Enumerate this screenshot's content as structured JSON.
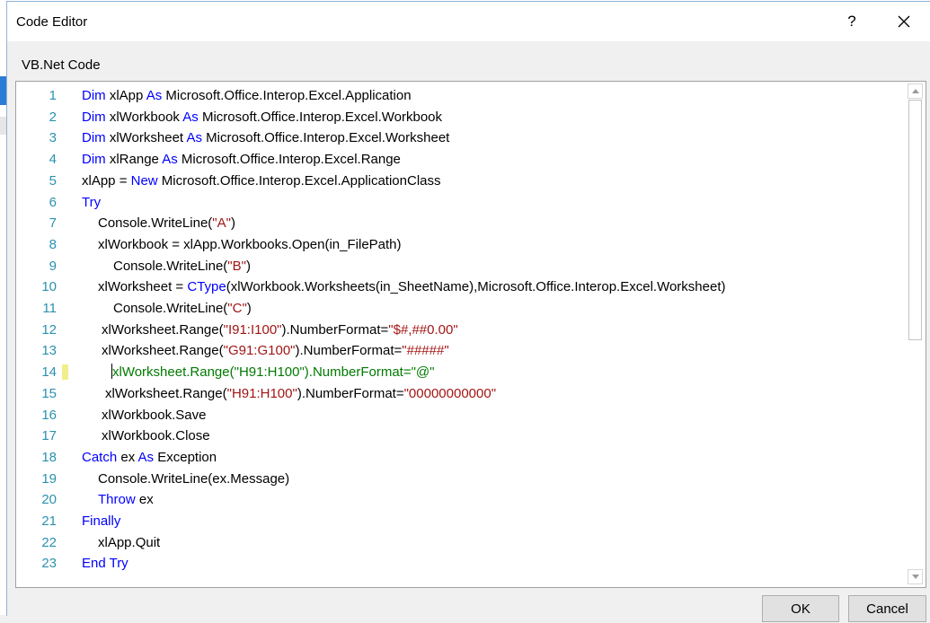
{
  "window": {
    "title": "Code Editor",
    "help_label": "?",
    "close_icon": "close-icon"
  },
  "section_label": "VB.Net Code",
  "editor": {
    "language": "VB.Net",
    "current_line": 14,
    "lines": [
      {
        "num": "1",
        "indent": 0,
        "tokens": [
          {
            "t": "Dim",
            "c": "kw"
          },
          {
            "t": " xlApp ",
            "c": ""
          },
          {
            "t": "As",
            "c": "kw"
          },
          {
            "t": " Microsoft.Office.Interop.Excel.Application",
            "c": ""
          }
        ]
      },
      {
        "num": "2",
        "indent": 0,
        "tokens": [
          {
            "t": "Dim",
            "c": "kw"
          },
          {
            "t": " xlWorkbook ",
            "c": ""
          },
          {
            "t": "As",
            "c": "kw"
          },
          {
            "t": " Microsoft.Office.Interop.Excel.Workbook",
            "c": ""
          }
        ]
      },
      {
        "num": "3",
        "indent": 0,
        "tokens": [
          {
            "t": "Dim",
            "c": "kw"
          },
          {
            "t": " xlWorksheet ",
            "c": ""
          },
          {
            "t": "As",
            "c": "kw"
          },
          {
            "t": " Microsoft.Office.Interop.Excel.Worksheet",
            "c": ""
          }
        ]
      },
      {
        "num": "4",
        "indent": 0,
        "tokens": [
          {
            "t": "Dim",
            "c": "kw"
          },
          {
            "t": " xlRange ",
            "c": ""
          },
          {
            "t": "As",
            "c": "kw"
          },
          {
            "t": " Microsoft.Office.Interop.Excel.Range",
            "c": ""
          }
        ]
      },
      {
        "num": "5",
        "indent": 0,
        "tokens": [
          {
            "t": "xlApp = ",
            "c": ""
          },
          {
            "t": "New",
            "c": "kw"
          },
          {
            "t": " Microsoft.Office.Interop.Excel.ApplicationClass",
            "c": ""
          }
        ]
      },
      {
        "num": "6",
        "indent": 0,
        "tokens": [
          {
            "t": "Try",
            "c": "kw"
          }
        ]
      },
      {
        "num": "7",
        "indent": 18,
        "tokens": [
          {
            "t": "Console.WriteLine(",
            "c": ""
          },
          {
            "t": "\"A\"",
            "c": "str"
          },
          {
            "t": ")",
            "c": ""
          }
        ]
      },
      {
        "num": "8",
        "indent": 18,
        "tokens": [
          {
            "t": "xlWorkbook = xlApp.Workbooks.Open(in_FilePath)",
            "c": ""
          }
        ]
      },
      {
        "num": "9",
        "indent": 35,
        "tokens": [
          {
            "t": "Console.WriteLine(",
            "c": ""
          },
          {
            "t": "\"B\"",
            "c": "str"
          },
          {
            "t": ")",
            "c": ""
          }
        ]
      },
      {
        "num": "10",
        "indent": 18,
        "tokens": [
          {
            "t": "xlWorksheet = ",
            "c": ""
          },
          {
            "t": "CType",
            "c": "kw"
          },
          {
            "t": "(xlWorkbook.Worksheets(in_SheetName),Microsoft.Office.Interop.Excel.Worksheet)",
            "c": ""
          }
        ]
      },
      {
        "num": "11",
        "indent": 35,
        "tokens": [
          {
            "t": "Console.WriteLine(",
            "c": ""
          },
          {
            "t": "\"C\"",
            "c": "str"
          },
          {
            "t": ")",
            "c": ""
          }
        ]
      },
      {
        "num": "12",
        "indent": 22,
        "tokens": [
          {
            "t": "xlWorksheet.Range(",
            "c": ""
          },
          {
            "t": "\"I91:I100\"",
            "c": "str"
          },
          {
            "t": ").NumberFormat=",
            "c": ""
          },
          {
            "t": "\"$#,##0.00\"",
            "c": "str"
          }
        ]
      },
      {
        "num": "13",
        "indent": 22,
        "tokens": [
          {
            "t": "xlWorksheet.Range(",
            "c": ""
          },
          {
            "t": "\"G91:G100\"",
            "c": "str"
          },
          {
            "t": ").NumberFormat=",
            "c": ""
          },
          {
            "t": "\"#####\"",
            "c": "str"
          }
        ]
      },
      {
        "num": "14",
        "indent": 33,
        "tokens": [
          {
            "t": "xlWorksheet.Range(\"H91:H100\").NumberFormat=\"@\"",
            "c": ""
          }
        ]
      },
      {
        "num": "15",
        "indent": 26,
        "tokens": [
          {
            "t": "xlWorksheet.Range(",
            "c": ""
          },
          {
            "t": "\"H91:H100\"",
            "c": "str"
          },
          {
            "t": ").NumberFormat=",
            "c": ""
          },
          {
            "t": "\"00000000000\"",
            "c": "str"
          }
        ]
      },
      {
        "num": "16",
        "indent": 22,
        "tokens": [
          {
            "t": "xlWorkbook.Save",
            "c": ""
          }
        ]
      },
      {
        "num": "17",
        "indent": 22,
        "tokens": [
          {
            "t": "xlWorkbook.Close",
            "c": ""
          }
        ]
      },
      {
        "num": "18",
        "indent": 0,
        "tokens": [
          {
            "t": "Catch",
            "c": "kw"
          },
          {
            "t": " ex ",
            "c": ""
          },
          {
            "t": "As",
            "c": "kw"
          },
          {
            "t": " Exception",
            "c": ""
          }
        ]
      },
      {
        "num": "19",
        "indent": 18,
        "tokens": [
          {
            "t": "Console.WriteLine(ex.Message)",
            "c": ""
          }
        ]
      },
      {
        "num": "20",
        "indent": 18,
        "tokens": [
          {
            "t": "Throw",
            "c": "kw"
          },
          {
            "t": " ex",
            "c": ""
          }
        ]
      },
      {
        "num": "21",
        "indent": 0,
        "tokens": [
          {
            "t": "Finally",
            "c": "kw"
          }
        ]
      },
      {
        "num": "22",
        "indent": 18,
        "tokens": [
          {
            "t": "xlApp.Quit",
            "c": ""
          }
        ]
      },
      {
        "num": "23",
        "indent": 0,
        "tokens": [
          {
            "t": "End Try",
            "c": "kw"
          }
        ]
      }
    ]
  },
  "scrollbar": {
    "up_icon": "chevron-up-icon",
    "down_icon": "chevron-down-icon"
  },
  "buttons": {
    "ok_label": "OK",
    "cancel_label": "Cancel"
  },
  "colors": {
    "keyword": "#0000ff",
    "string": "#a31515",
    "line_number": "#2b91af",
    "current_line_text": "#007a00",
    "change_marker": "#f0ef8c"
  }
}
